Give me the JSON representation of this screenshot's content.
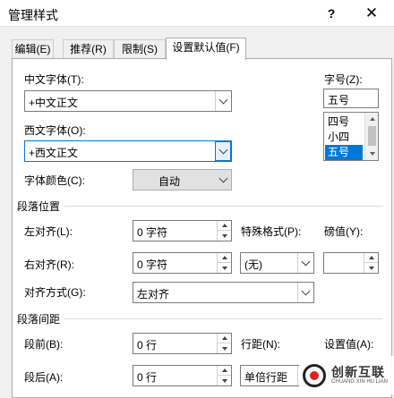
{
  "window": {
    "title": "管理样式",
    "help_glyph": "?",
    "close_glyph": "✕"
  },
  "tabs": [
    {
      "label": "编辑(E)"
    },
    {
      "label": "推荐(R)"
    },
    {
      "label": "限制(S)"
    },
    {
      "label": "设置默认值(F)",
      "active": true
    }
  ],
  "font": {
    "chinese_label": "中文字体(T):",
    "chinese_value": "+中文正文",
    "western_label": "西文字体(O):",
    "western_value": "+西文正文",
    "color_label": "字体颜色(C):",
    "color_value": "自动",
    "size_label": "字号(Z):",
    "size_value": "五号",
    "size_list": [
      "四号",
      "小四",
      "五号"
    ],
    "size_selected": "五号"
  },
  "paragraph_position": {
    "section": "段落位置",
    "left_indent_label": "左对齐(L):",
    "left_indent_value": "0 字符",
    "right_indent_label": "右对齐(R):",
    "right_indent_value": "0 字符",
    "special_label": "特殊格式(P):",
    "special_value": "(无)",
    "by_label": "磅值(Y):",
    "by_value": "",
    "alignment_label": "对齐方式(G):",
    "alignment_value": "左对齐"
  },
  "paragraph_spacing": {
    "section": "段落间距",
    "before_label": "段前(B):",
    "before_value": "0 行",
    "after_label": "段后(A):",
    "after_value": "0 行",
    "line_spacing_label": "行距(N):",
    "line_spacing_value": "单倍行距",
    "at_label": "设置值(A):"
  },
  "watermark": {
    "cn": "创新互联",
    "en": "CHUANG XIN HU LIAN"
  }
}
